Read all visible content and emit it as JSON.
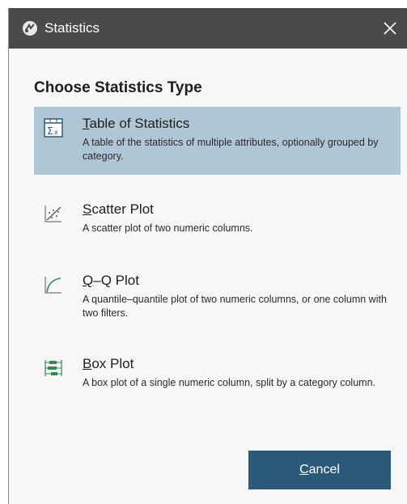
{
  "window": {
    "title": "Statistics",
    "close_glyph": "✕"
  },
  "heading": "Choose Statistics Type",
  "options": [
    {
      "mnemonic": "T",
      "title_rest": "able of Statistics",
      "description": "A table of the statistics of multiple attributes, optionally grouped by category.",
      "icon": "table-statistics-icon",
      "selected": true
    },
    {
      "mnemonic": "S",
      "title_rest": "catter Plot",
      "description": "A scatter plot of two numeric columns.",
      "icon": "scatter-plot-icon",
      "selected": false
    },
    {
      "mnemonic": "Q",
      "title_rest": "–Q Plot",
      "description": "A quantile–quantile plot of two numeric columns, or one column with two filters.",
      "icon": "qq-plot-icon",
      "selected": false
    },
    {
      "mnemonic": "B",
      "title_rest": "ox Plot",
      "description": "A box plot of a single numeric column, split by a category column.",
      "icon": "box-plot-icon",
      "selected": false
    }
  ],
  "buttons": {
    "cancel_mnemonic": "C",
    "cancel_rest": "ancel"
  },
  "colors": {
    "titlebar": "#4a4a4a",
    "selected_bg": "#afc6d5",
    "button_bg": "#2a5a7a",
    "icon_green": "#2e8b57",
    "icon_blue": "#2a5a7a"
  }
}
